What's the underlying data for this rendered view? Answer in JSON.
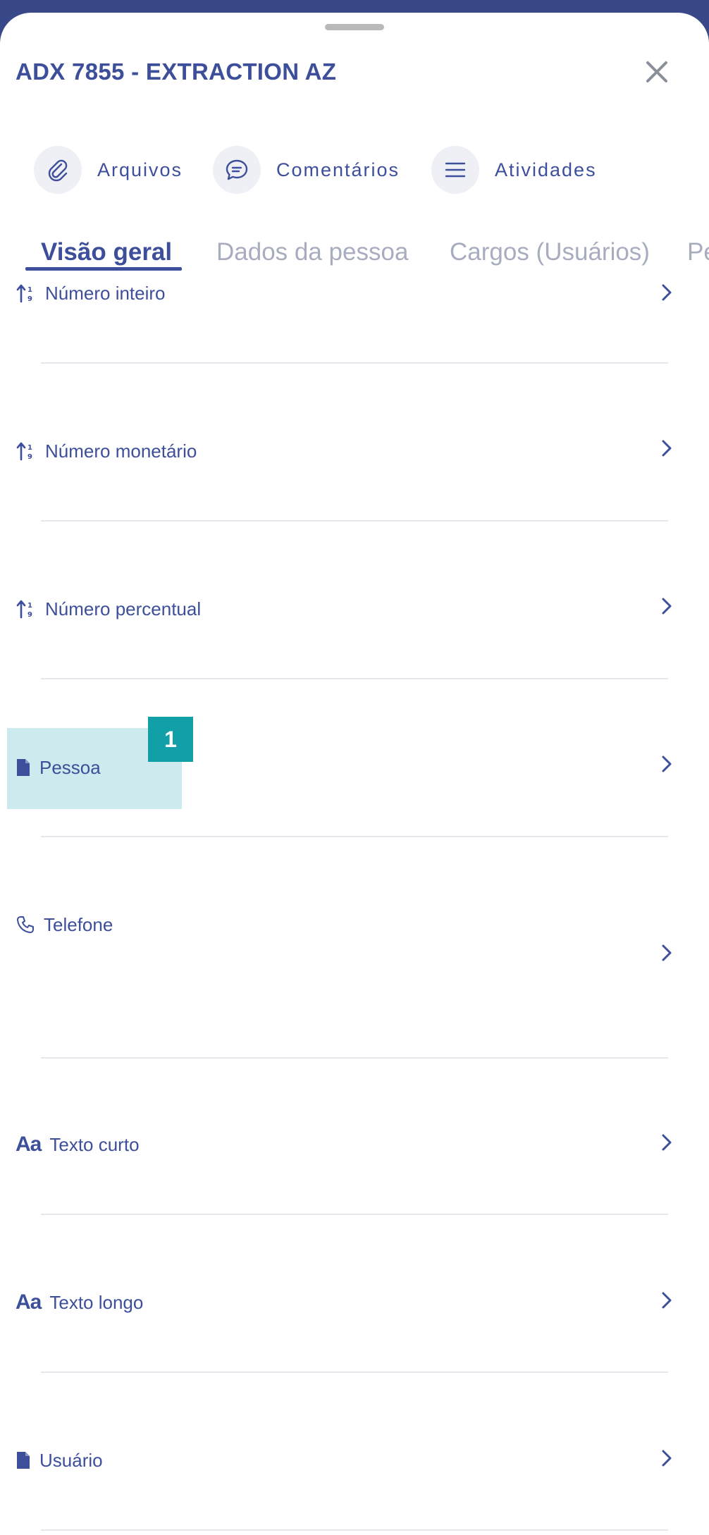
{
  "header": {
    "title": "ADX 7855 - EXTRACTION AZ"
  },
  "actions": [
    {
      "label": "Arquivos",
      "icon": "paperclip-icon"
    },
    {
      "label": "Comentários",
      "icon": "comment-icon"
    },
    {
      "label": "Atividades",
      "icon": "list-icon"
    }
  ],
  "tabs": [
    {
      "label": "Visão geral",
      "active": true
    },
    {
      "label": "Dados da pessoa",
      "active": false
    },
    {
      "label": "Cargos (Usuários)",
      "active": false
    },
    {
      "label": "Pe",
      "active": false
    }
  ],
  "fields": [
    {
      "label": "Número inteiro",
      "icon": "number-sort-icon"
    },
    {
      "label": "Número monetário",
      "icon": "number-sort-icon"
    },
    {
      "label": "Número percentual",
      "icon": "number-sort-icon"
    },
    {
      "label": "Pessoa",
      "icon": "document-icon"
    },
    {
      "label": "Telefone",
      "icon": "phone-icon"
    },
    {
      "label": "Texto curto",
      "icon": "text-aa-icon",
      "icon_text": "Aa"
    },
    {
      "label": "Texto longo",
      "icon": "text-aa-icon",
      "icon_text": "Aa"
    },
    {
      "label": "Usuário",
      "icon": "document-icon"
    }
  ],
  "annotation": {
    "badge": "1"
  },
  "colors": {
    "primary": "#3d4f9a",
    "header_band": "#384889",
    "inactive_tab": "#a7adbf",
    "highlight": "#cdeaee",
    "badge": "#12a0a8",
    "divider": "#e6e8ef"
  }
}
